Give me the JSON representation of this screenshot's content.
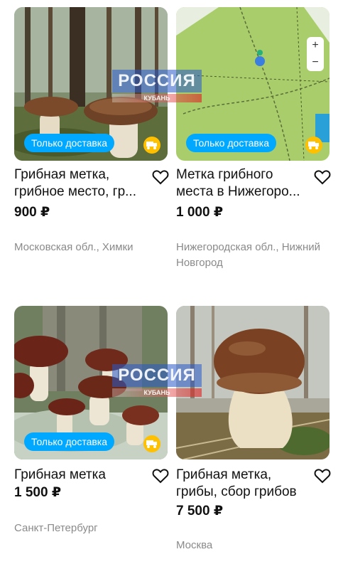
{
  "listings": [
    {
      "title": "Грибная метка, грибное место, гр...",
      "badge": "Только доставка",
      "price": "900 ₽",
      "location": "Московская обл., Химки",
      "watermark": {
        "top": "РОССИЯ",
        "bottom": "КУБАНЬ"
      }
    },
    {
      "title": "Метка грибного места в Нижегоро...",
      "badge": "Только доставка",
      "price": "1 000 ₽",
      "location": "Нижегородская обл., Нижний Новгород",
      "map_controls": {
        "zoom_in": "+",
        "zoom_out": "−"
      }
    },
    {
      "title": "Грибная метка",
      "badge": "Только доставка",
      "price": "1 500 ₽",
      "location": "Санкт-Петербург",
      "watermark": {
        "top": "РОССИЯ",
        "bottom": "КУБАНЬ"
      }
    },
    {
      "title": "Грибная метка, грибы, сбор грибов",
      "price": "7 500 ₽",
      "location": "Москва"
    }
  ],
  "icons": {
    "favorite": "heart-outline-icon",
    "delivery": "truck-icon"
  },
  "colors": {
    "badge": "#00a8ff",
    "delivery": "#ffc000",
    "location_text": "#8a8a8a"
  }
}
